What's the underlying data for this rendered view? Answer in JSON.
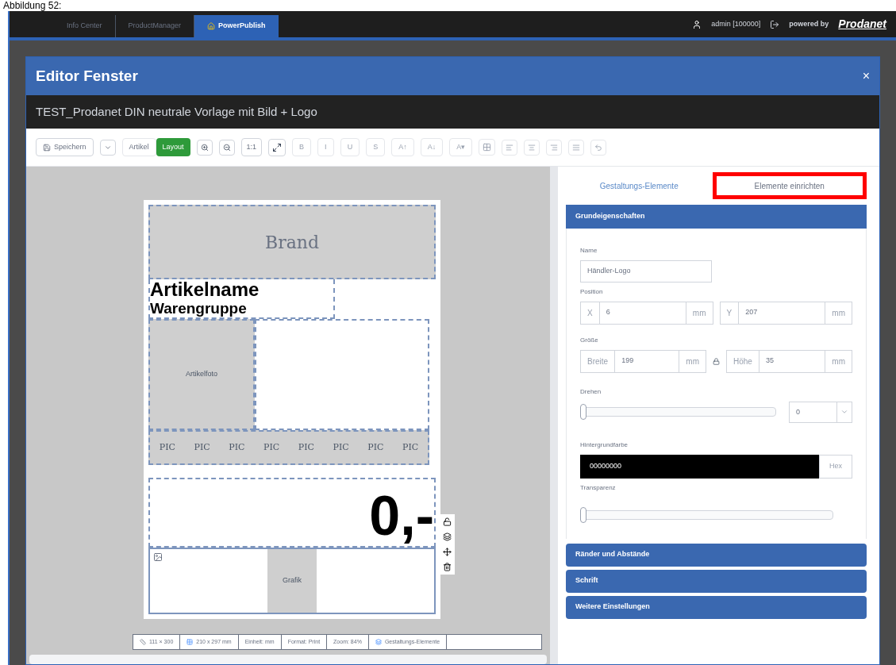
{
  "caption": "Abbildung 52:",
  "nav": {
    "tabs": [
      {
        "label": "Info Center",
        "selected": false
      },
      {
        "label": "ProductManager",
        "selected": false
      },
      {
        "label": "PowerPublish",
        "selected": true
      }
    ],
    "user": "admin [100000]",
    "powered_by": "powered by",
    "brand": "Prodanet"
  },
  "dialog": {
    "title": "Editor Fenster",
    "close": "×",
    "document_title": "TEST_Prodanet DIN neutrale Vorlage mit Bild + Logo"
  },
  "toolbar": {
    "save": "Speichern",
    "modes": [
      {
        "label": "Artikel",
        "selected": false
      },
      {
        "label": "Layout",
        "selected": true
      }
    ],
    "zoom_reset": "1:1",
    "format_buttons": [
      "B",
      "I",
      "U",
      "S",
      "A↑",
      "A↓",
      "A▾"
    ]
  },
  "canvas": {
    "brand": "Brand",
    "article_name": "Artikelname",
    "product_group": "Warengruppe",
    "photo": "Artikelfoto",
    "pics": [
      "PIC",
      "PIC",
      "PIC",
      "PIC",
      "PIC",
      "PIC",
      "PIC",
      "PIC"
    ],
    "price": "0,-",
    "logo": "Grafik"
  },
  "status_bar": [
    "111 × 300",
    "210 x 297 mm",
    "Einheit: mm",
    "Format: Print",
    "Zoom: 84%",
    "Gestaltungs-Elemente"
  ],
  "panel": {
    "tabs": [
      {
        "label": "Gestaltungs-Elemente",
        "selected": false
      },
      {
        "label": "Elemente einrichten",
        "selected": true
      }
    ],
    "section": "Grundeigenschaften",
    "name_label": "Name",
    "name_value": "Händler-Logo",
    "position_label": "Position",
    "x_label": "X",
    "x_value": "6",
    "x_unit": "mm",
    "y_label": "Y",
    "y_value": "207",
    "y_unit": "mm",
    "size_label": "Größe",
    "width_label": "Breite",
    "width_value": "199",
    "width_unit": "mm",
    "height_label": "Höhe",
    "height_value": "35",
    "height_unit": "mm",
    "rotate_label": "Drehen",
    "rotate": {
      "level": 0
    },
    "rotate_value": "0",
    "bg_label": "Hintergrundfarbe",
    "bg_value": "00000000",
    "bg_mode": "Hex",
    "transparency_label": "Transparenz",
    "transparency": {
      "level": 0
    },
    "sections": [
      "Ränder und Abstände",
      "Schrift",
      "Weitere Einstellungen"
    ]
  }
}
